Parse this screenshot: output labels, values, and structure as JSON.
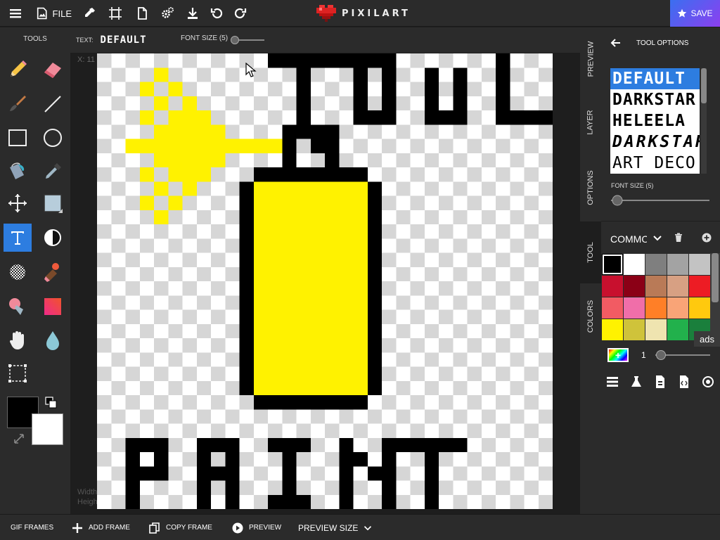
{
  "app": {
    "logo_text": "PIXILART",
    "file_label": "FILE",
    "save_label": "SAVE"
  },
  "tools": {
    "title": "TOOLS",
    "items": [
      "pencil",
      "eraser",
      "brush",
      "line",
      "rectangle",
      "ellipse",
      "bucket",
      "eyedropper",
      "move",
      "select",
      "text",
      "dither",
      "checker",
      "stamp",
      "shade",
      "gradient",
      "hand",
      "blur",
      "crop"
    ],
    "active": "text"
  },
  "text_options": {
    "text_label": "TEXT:",
    "text_value": "DEFAULT",
    "font_size_label": "FONT SIZE (5)"
  },
  "canvas": {
    "coords": "X: 11",
    "width_label": "Width",
    "height_label": "Heigh"
  },
  "side_tabs": [
    "PREVIEW",
    "LAYER",
    "OPTIONS",
    "TOOL",
    "COLORS"
  ],
  "tool_options": {
    "title": "TOOL OPTIONS",
    "fonts": [
      "DEFAULT",
      "DARKSTAR",
      "HELEELA",
      "DARKSTAR",
      "ART DECO"
    ],
    "selected_font": "DEFAULT",
    "font_size_label": "FONT SIZE (5)"
  },
  "palette": {
    "name": "COMMON",
    "colors": [
      "#000000",
      "#ffffff",
      "#7f7f7f",
      "#a3a3a3",
      "#c3c3c3",
      "#c8102e",
      "#8b0016",
      "#b97a57",
      "#d7a083",
      "#ed1c24",
      "#f25b63",
      "#f06ea9",
      "#ff7f27",
      "#f9a477",
      "#ffc90e",
      "#fff200",
      "#cfc33a",
      "#efe4b0",
      "#22b14c",
      "#1a7f3c"
    ],
    "selected": "#000000",
    "ads_label": "ads",
    "brush_size": "1"
  },
  "bottom": {
    "gif_frames": "GIF FRAMES",
    "add_frame": "ADD FRAME",
    "copy_frame": "COPY FRAME",
    "preview": "PREVIEW",
    "preview_size": "PREVIEW SIZE"
  }
}
